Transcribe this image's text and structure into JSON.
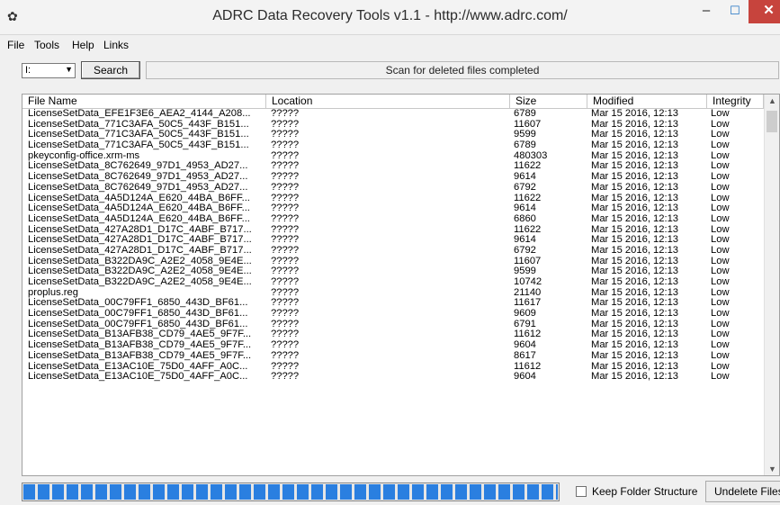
{
  "window": {
    "title": "ADRC Data Recovery Tools v1.1 - http://www.adrc.com/",
    "close_color": "#c7443d"
  },
  "menu": [
    {
      "label": "File"
    },
    {
      "label": "Tools"
    },
    {
      "label": "Help"
    },
    {
      "label": "Links"
    }
  ],
  "toolbar": {
    "drive_value": "I:",
    "search_label": "Search",
    "status_text": "Scan for deleted files completed"
  },
  "columns": [
    "File Name",
    "Location",
    "Size",
    "Modified",
    "Integrity"
  ],
  "rows": [
    {
      "name": "LicenseSetData_EFE1F3E6_AEA2_4144_A208...",
      "loc": "?????",
      "size": "6789",
      "mod": "Mar 15 2016, 12:13",
      "int": "Low"
    },
    {
      "name": "LicenseSetData_771C3AFA_50C5_443F_B151...",
      "loc": "?????",
      "size": "11607",
      "mod": "Mar 15 2016, 12:13",
      "int": "Low"
    },
    {
      "name": "LicenseSetData_771C3AFA_50C5_443F_B151...",
      "loc": "?????",
      "size": "9599",
      "mod": "Mar 15 2016, 12:13",
      "int": "Low"
    },
    {
      "name": "LicenseSetData_771C3AFA_50C5_443F_B151...",
      "loc": "?????",
      "size": "6789",
      "mod": "Mar 15 2016, 12:13",
      "int": "Low"
    },
    {
      "name": "pkeyconfig-office.xrm-ms",
      "loc": "?????",
      "size": "480303",
      "mod": "Mar 15 2016, 12:13",
      "int": "Low"
    },
    {
      "name": "LicenseSetData_8C762649_97D1_4953_AD27...",
      "loc": "?????",
      "size": "11622",
      "mod": "Mar 15 2016, 12:13",
      "int": "Low"
    },
    {
      "name": "LicenseSetData_8C762649_97D1_4953_AD27...",
      "loc": "?????",
      "size": "9614",
      "mod": "Mar 15 2016, 12:13",
      "int": "Low"
    },
    {
      "name": "LicenseSetData_8C762649_97D1_4953_AD27...",
      "loc": "?????",
      "size": "6792",
      "mod": "Mar 15 2016, 12:13",
      "int": "Low"
    },
    {
      "name": "LicenseSetData_4A5D124A_E620_44BA_B6FF...",
      "loc": "?????",
      "size": "11622",
      "mod": "Mar 15 2016, 12:13",
      "int": "Low"
    },
    {
      "name": "LicenseSetData_4A5D124A_E620_44BA_B6FF...",
      "loc": "?????",
      "size": "9614",
      "mod": "Mar 15 2016, 12:13",
      "int": "Low"
    },
    {
      "name": "LicenseSetData_4A5D124A_E620_44BA_B6FF...",
      "loc": "?????",
      "size": "6860",
      "mod": "Mar 15 2016, 12:13",
      "int": "Low"
    },
    {
      "name": "LicenseSetData_427A28D1_D17C_4ABF_B717...",
      "loc": "?????",
      "size": "11622",
      "mod": "Mar 15 2016, 12:13",
      "int": "Low"
    },
    {
      "name": "LicenseSetData_427A28D1_D17C_4ABF_B717...",
      "loc": "?????",
      "size": "9614",
      "mod": "Mar 15 2016, 12:13",
      "int": "Low"
    },
    {
      "name": "LicenseSetData_427A28D1_D17C_4ABF_B717...",
      "loc": "?????",
      "size": "6792",
      "mod": "Mar 15 2016, 12:13",
      "int": "Low"
    },
    {
      "name": "LicenseSetData_B322DA9C_A2E2_4058_9E4E...",
      "loc": "?????",
      "size": "11607",
      "mod": "Mar 15 2016, 12:13",
      "int": "Low"
    },
    {
      "name": "LicenseSetData_B322DA9C_A2E2_4058_9E4E...",
      "loc": "?????",
      "size": "9599",
      "mod": "Mar 15 2016, 12:13",
      "int": "Low"
    },
    {
      "name": "LicenseSetData_B322DA9C_A2E2_4058_9E4E...",
      "loc": "?????",
      "size": "10742",
      "mod": "Mar 15 2016, 12:13",
      "int": "Low"
    },
    {
      "name": "proplus.reg",
      "loc": "?????",
      "size": "21140",
      "mod": "Mar 15 2016, 12:13",
      "int": "Low"
    },
    {
      "name": "LicenseSetData_00C79FF1_6850_443D_BF61...",
      "loc": "?????",
      "size": "11617",
      "mod": "Mar 15 2016, 12:13",
      "int": "Low"
    },
    {
      "name": "LicenseSetData_00C79FF1_6850_443D_BF61...",
      "loc": "?????",
      "size": "9609",
      "mod": "Mar 15 2016, 12:13",
      "int": "Low"
    },
    {
      "name": "LicenseSetData_00C79FF1_6850_443D_BF61...",
      "loc": "?????",
      "size": "6791",
      "mod": "Mar 15 2016, 12:13",
      "int": "Low"
    },
    {
      "name": "LicenseSetData_B13AFB38_CD79_4AE5_9F7F...",
      "loc": "?????",
      "size": "11612",
      "mod": "Mar 15 2016, 12:13",
      "int": "Low"
    },
    {
      "name": "LicenseSetData_B13AFB38_CD79_4AE5_9F7F...",
      "loc": "?????",
      "size": "9604",
      "mod": "Mar 15 2016, 12:13",
      "int": "Low"
    },
    {
      "name": "LicenseSetData_B13AFB38_CD79_4AE5_9F7F...",
      "loc": "?????",
      "size": "8617",
      "mod": "Mar 15 2016, 12:13",
      "int": "Low"
    },
    {
      "name": "LicenseSetData_E13AC10E_75D0_4AFF_A0C...",
      "loc": "?????",
      "size": "11612",
      "mod": "Mar 15 2016, 12:13",
      "int": "Low"
    },
    {
      "name": "LicenseSetData_E13AC10E_75D0_4AFF_A0C...",
      "loc": "?????",
      "size": "9604",
      "mod": "Mar 15 2016, 12:13",
      "int": "Low"
    }
  ],
  "footer": {
    "progress_percent": 100,
    "progress_color": "#2a7fe0",
    "keep_folder_label": "Keep Folder Structure",
    "keep_folder_checked": false,
    "undelete_label": "Undelete Files"
  }
}
